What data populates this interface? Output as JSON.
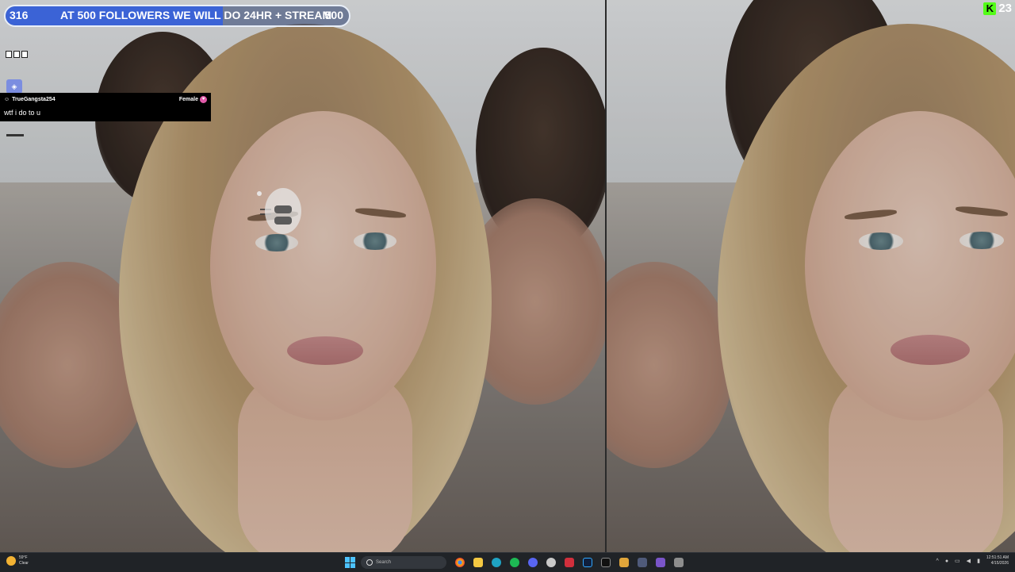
{
  "follower_goal": {
    "current": "316",
    "message": "AT 500 FOLLOWERS WE WILL DO 24HR + STREAM",
    "target": "500",
    "progress": 0.632,
    "fill_color": "#3b63d6"
  },
  "kick_viewers": {
    "icon": "kick-logo-icon",
    "count": "23",
    "color": "#53fc18"
  },
  "chat": {
    "username": "TrueGangsta254",
    "gender": "Female",
    "message": "wtf i do to u"
  },
  "taskbar": {
    "weather": {
      "temp": "59°F",
      "condition": "Clear"
    },
    "search_placeholder": "Search",
    "clock_time": "12:51:51 AM",
    "clock_date": "4/15/2026",
    "apps": [
      "chrome-icon",
      "file-explorer-icon",
      "edge-icon",
      "spotify-icon",
      "discord-icon",
      "obs-icon",
      "adobe-icon",
      "photoshop-icon",
      "terminal-icon",
      "app-icon",
      "app-icon",
      "app-icon",
      "app-icon"
    ]
  }
}
